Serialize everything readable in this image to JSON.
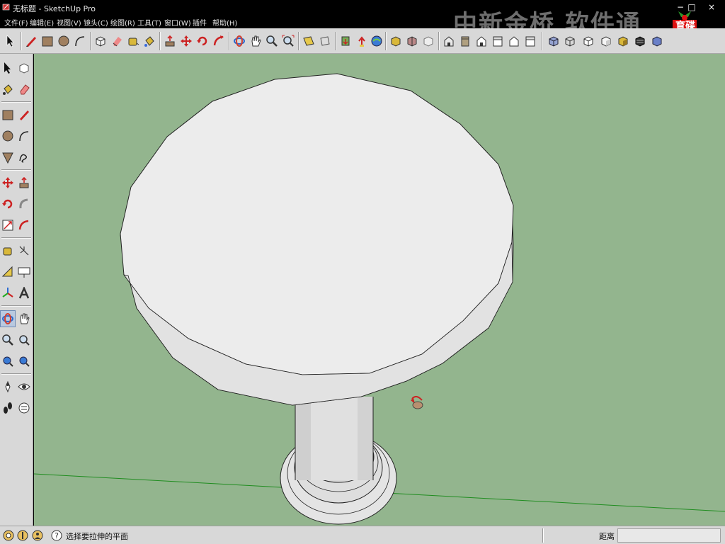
{
  "window": {
    "title": "无标题 - SketchUp Pro",
    "minimize": "−",
    "maximize": "□",
    "close": "×"
  },
  "menu": [
    {
      "id": "file",
      "label": "文件(F)"
    },
    {
      "id": "edit",
      "label": "编辑(E)"
    },
    {
      "id": "view",
      "label": "视图(V)"
    },
    {
      "id": "camera",
      "label": "镜头(C)"
    },
    {
      "id": "draw",
      "label": "绘图(R)"
    },
    {
      "id": "tools",
      "label": "工具(T)"
    },
    {
      "id": "window",
      "label": "窗口(W)"
    },
    {
      "id": "plugins",
      "label": "插件"
    },
    {
      "id": "help",
      "label": "帮助(H)"
    }
  ],
  "watermark": {
    "text": "中新金桥 软件通",
    "logo_text_1": "育碟",
    "logo_text_2": "软件"
  },
  "top_toolbar": [
    "select-icon",
    "pencil-line-icon",
    "rectangle-icon",
    "circle-icon",
    "arc-icon",
    "make-component-icon",
    "eraser-icon",
    "tape-measure-icon",
    "paint-bucket-icon",
    "push-pull-icon",
    "move-icon",
    "rotate-icon",
    "follow-me-icon",
    "orbit-icon",
    "pan-icon",
    "zoom-icon",
    "zoom-extents-icon",
    "section-plane-icon",
    "previous-view-icon",
    "get-models-icon",
    "share-model-icon",
    "warehouse-icon",
    "google-earth-icon",
    "components-icon",
    "styles-icon",
    "paint-icon",
    "iso-view-icon",
    "top-view-icon",
    "front-view-icon",
    "right-view-icon",
    "back-view-icon",
    "left-view-icon",
    "xray-icon",
    "wireframe-icon",
    "hidden-line-icon",
    "shaded-icon",
    "shaded-texture-icon",
    "monochrome-icon"
  ],
  "left_toolbar": [
    "select-icon",
    "component-icon",
    "paint-bucket-icon",
    "eraser-icon",
    "rectangle-icon",
    "line-icon",
    "circle-icon",
    "arc-icon",
    "polygon-icon",
    "freehand-icon",
    "move-icon",
    "push-pull-icon",
    "rotate-icon",
    "follow-me-icon",
    "scale-icon",
    "offset-icon",
    "tape-measure-icon",
    "dimension-icon",
    "protractor-icon",
    "text-icon",
    "axes-icon",
    "3d-text-icon",
    "orbit-icon",
    "pan-icon",
    "zoom-icon",
    "zoom-window-icon",
    "previous-icon",
    "zoom-extents-icon",
    "position-camera-icon",
    "look-around-icon",
    "walk-icon",
    "section-plane-icon"
  ],
  "status": {
    "hint": "选择要拉伸的平面",
    "measure_label": "距离",
    "measure_value": ""
  },
  "colors": {
    "viewport_bg": "#93b58e",
    "chrome_bg": "#d8d8d8",
    "model_white": "#e9e9e9",
    "green_axis": "#1f8c1f"
  }
}
